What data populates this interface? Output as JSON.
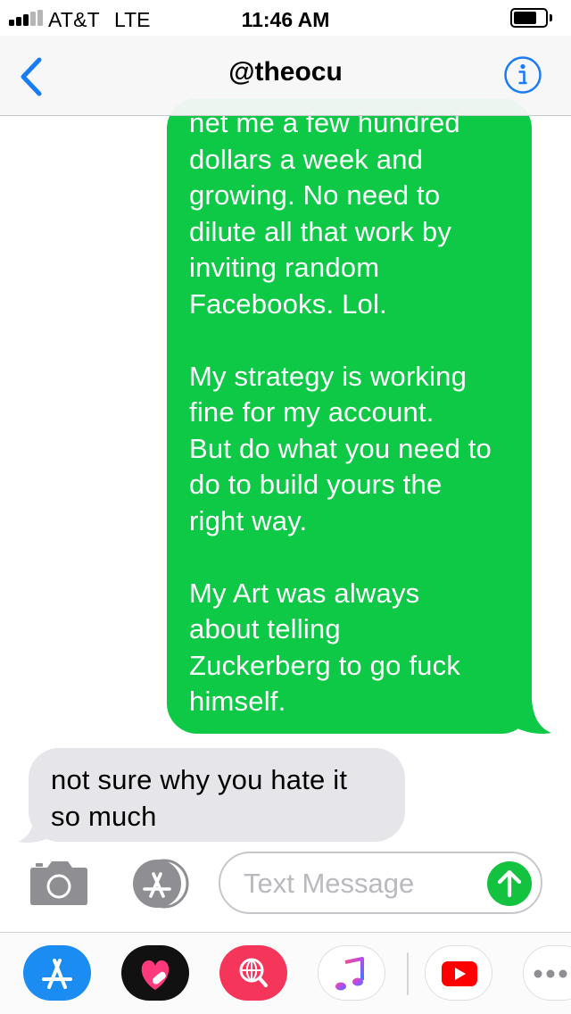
{
  "status_bar": {
    "carrier": "AT&T",
    "network": "LTE",
    "time": "11:46 AM",
    "signal_bars_filled": 3,
    "signal_bars_total": 5
  },
  "nav": {
    "title": "@theocu",
    "back_icon": "chevron-left-icon",
    "info_icon": "info-circle-icon",
    "accent_color": "#1a7cf5"
  },
  "messages": [
    {
      "direction": "sent",
      "color": "#0ec946",
      "text": "net me a few hundred\ndollars a week and\ngrowing. No need to\ndilute all that work by\ninviting random\nFacebooks. Lol.\n\nMy strategy is working\nfine for my account.\nBut do what you need to\ndo to build yours the\nright way.\n\nMy Art was always\nabout telling\nZuckerberg to go fuck\nhimself."
    },
    {
      "direction": "received",
      "color": "#e5e5ea",
      "text": "not sure why you hate it\nso much"
    }
  ],
  "composer": {
    "placeholder": "Text Message",
    "value": "",
    "camera_icon": "camera-icon",
    "apps_icon": "app-store-icon",
    "send_icon": "arrow-up-icon",
    "send_color": "#13c23f"
  },
  "app_drawer": [
    {
      "name": "App Store",
      "icon": "app-store-icon"
    },
    {
      "name": "Digital Touch",
      "icon": "digital-touch-heart-icon"
    },
    {
      "name": "Images Search",
      "icon": "globe-search-icon"
    },
    {
      "name": "Music",
      "icon": "music-note-icon"
    },
    {
      "name": "YouTube",
      "icon": "youtube-play-icon"
    },
    {
      "name": "More",
      "icon": "more-dots-icon"
    }
  ]
}
